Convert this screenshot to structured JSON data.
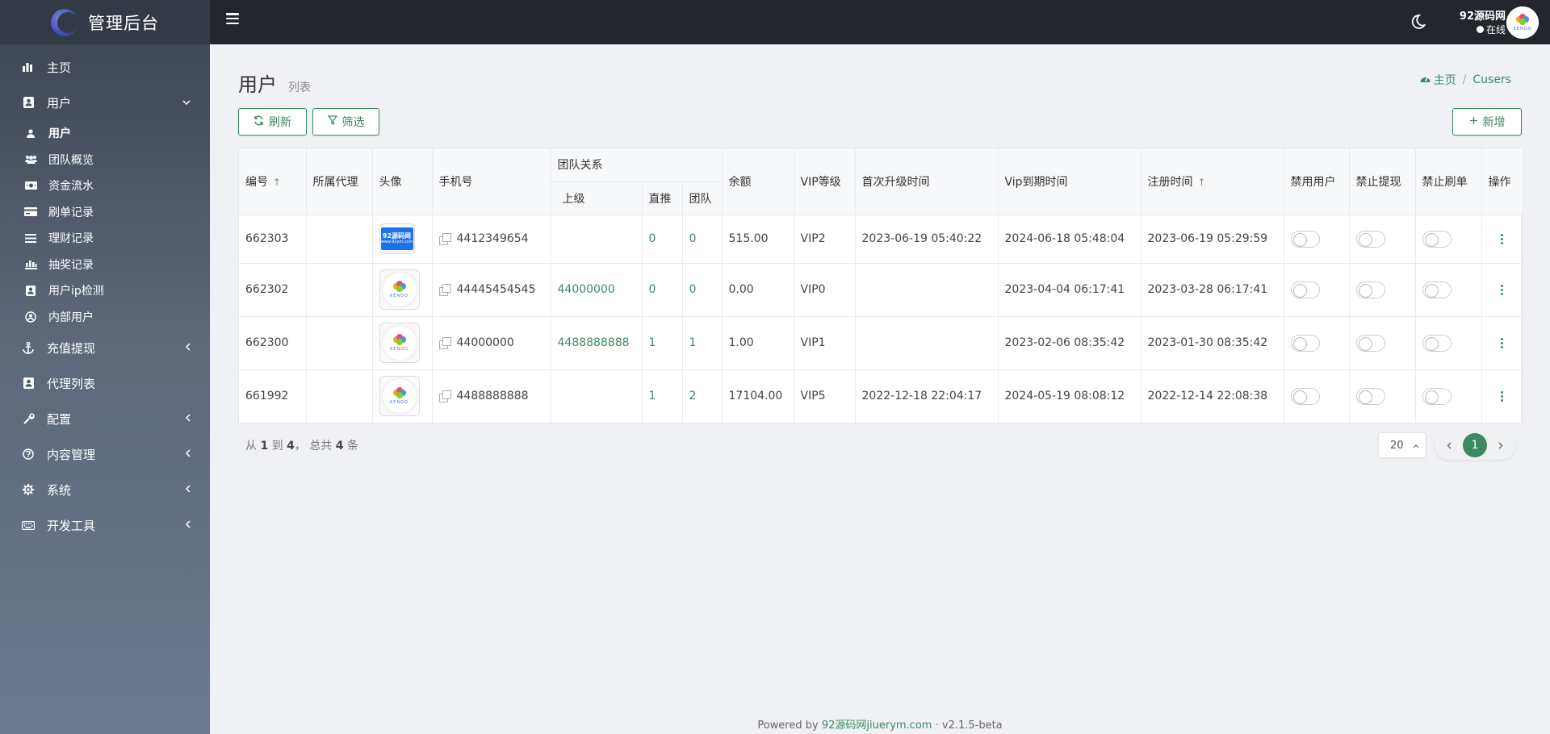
{
  "brand": {
    "title": "管理后台"
  },
  "sidebar": {
    "items": [
      {
        "label": "主页",
        "icon": "chart-bar-icon"
      },
      {
        "label": "用户",
        "icon": "user-card-icon"
      },
      {
        "label": "充值提现",
        "icon": "anchor-icon"
      },
      {
        "label": "代理列表",
        "icon": "user-card-icon"
      },
      {
        "label": "配置",
        "icon": "tool-icon"
      },
      {
        "label": "内容管理",
        "icon": "question-icon"
      },
      {
        "label": "系统",
        "icon": "gear-icon"
      },
      {
        "label": "开发工具",
        "icon": "keyboard-icon"
      }
    ],
    "sub": [
      {
        "label": "用户",
        "icon": "user-icon"
      },
      {
        "label": "团队概览",
        "icon": "users-icon"
      },
      {
        "label": "资金流水",
        "icon": "money-icon"
      },
      {
        "label": "刷单记录",
        "icon": "card-icon"
      },
      {
        "label": "理财记录",
        "icon": "list-icon"
      },
      {
        "label": "抽奖记录",
        "icon": "bars-icon"
      },
      {
        "label": "用户ip检测",
        "icon": "user-card-icon"
      },
      {
        "label": "内部用户",
        "icon": "user-circle-icon"
      }
    ]
  },
  "topbar": {
    "user_name": "92源码网",
    "user_status": "在线"
  },
  "page": {
    "title": "用户",
    "subtitle": "列表",
    "breadcrumb_home": "主页",
    "breadcrumb_current": "Cusers",
    "refresh_label": "刷新",
    "filter_label": "筛选",
    "add_label": "新增"
  },
  "table": {
    "headers": {
      "id": "编号",
      "agent": "所属代理",
      "avatar": "头像",
      "phone": "手机号",
      "team": "团队关系",
      "parent": "上级",
      "direct": "直推",
      "team_count": "团队",
      "balance": "余额",
      "vip": "VIP等级",
      "first_upgrade": "首次升级时间",
      "vip_expire": "Vip到期时间",
      "register": "注册时间",
      "ban_user": "禁用用户",
      "ban_withdraw": "禁止提现",
      "ban_order": "禁止刷单",
      "actions": "操作"
    },
    "rows": [
      {
        "id": "662303",
        "agent": "",
        "avatar": "92源码网",
        "phone": "4412349654",
        "parent": "",
        "direct": "0",
        "team": "0",
        "balance": "515.00",
        "vip": "VIP2",
        "first_upgrade": "2023-06-19 05:40:22",
        "vip_expire": "2024-06-18 05:48:04",
        "register": "2023-06-19 05:29:59"
      },
      {
        "id": "662302",
        "agent": "",
        "avatar": "kendo",
        "phone": "44445454545",
        "parent": "44000000",
        "direct": "0",
        "team": "0",
        "balance": "0.00",
        "vip": "VIP0",
        "first_upgrade": "",
        "vip_expire": "2023-04-04 06:17:41",
        "register": "2023-03-28 06:17:41"
      },
      {
        "id": "662300",
        "agent": "",
        "avatar": "kendo",
        "phone": "44000000",
        "parent": "4488888888",
        "direct": "1",
        "team": "1",
        "balance": "1.00",
        "vip": "VIP1",
        "first_upgrade": "",
        "vip_expire": "2023-02-06 08:35:42",
        "register": "2023-01-30 08:35:42"
      },
      {
        "id": "661992",
        "agent": "",
        "avatar": "kendo",
        "phone": "4488888888",
        "parent": "",
        "direct": "1",
        "team": "2",
        "balance": "17104.00",
        "vip": "VIP5",
        "first_upgrade": "2022-12-18 22:04:17",
        "vip_expire": "2024-05-19 08:08:12",
        "register": "2022-12-14 22:08:38"
      }
    ]
  },
  "pagination": {
    "from_label": "从",
    "from": "1",
    "to_label": "到",
    "to": "4",
    "total_label": "， 总共",
    "total": "4",
    "unit": "条",
    "page_size": "20",
    "current_page": "1"
  },
  "footer": {
    "powered_by": "Powered by",
    "link": "92源码网jiuerym.com",
    "dot": "·",
    "version": "v2.1.5-beta"
  },
  "colors": {
    "accent": "#3c8a64",
    "topbar": "#23262d",
    "sidebar_top": "#3b4250"
  },
  "avatar_images": {
    "kendo_text": "KENDO",
    "logo_92_line1": "92源码网",
    "logo_92_line2": "www.92ym.com"
  }
}
